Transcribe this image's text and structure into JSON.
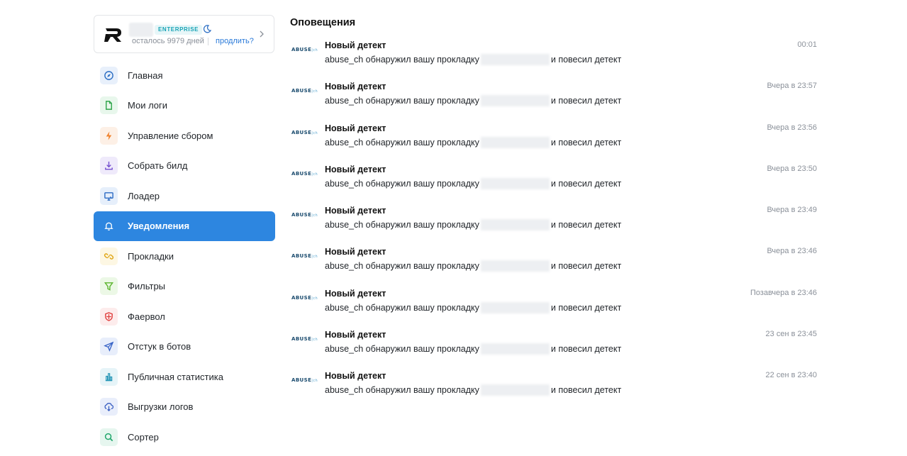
{
  "account": {
    "plan_badge": "ENTERPRISE",
    "days_left": "осталось 9979 дней",
    "renew_link": "продлить?"
  },
  "sidebar": {
    "items": [
      {
        "label": "Главная",
        "icon": "compass-icon",
        "bg": "#e8f0fb",
        "color": "#2d6fc4"
      },
      {
        "label": "Мои логи",
        "icon": "file-icon",
        "bg": "#e8f7ec",
        "color": "#2fa54a"
      },
      {
        "label": "Управление сбором",
        "icon": "lightning-icon",
        "bg": "#fdf0e6",
        "color": "#f0802a"
      },
      {
        "label": "Собрать билд",
        "icon": "download-icon",
        "bg": "#efeafb",
        "color": "#7650d0"
      },
      {
        "label": "Лоадер",
        "icon": "monitor-icon",
        "bg": "#e6effb",
        "color": "#2c6bc4"
      },
      {
        "label": "Уведомления",
        "icon": "bell-icon",
        "bg": "transparent",
        "color": "#ffffff",
        "active": true
      },
      {
        "label": "Прокладки",
        "icon": "link-icon",
        "bg": "#fdf7e3",
        "color": "#e0a616"
      },
      {
        "label": "Фильтры",
        "icon": "filter-icon",
        "bg": "#ecf8e6",
        "color": "#5bb42e"
      },
      {
        "label": "Фаервол",
        "icon": "shield-icon",
        "bg": "#fdecec",
        "color": "#e0403f"
      },
      {
        "label": "Отстук в ботов",
        "icon": "send-icon",
        "bg": "#e8eefb",
        "color": "#3561c6"
      },
      {
        "label": "Публичная статистика",
        "icon": "bar-chart-icon",
        "bg": "#e6f4f8",
        "color": "#2395b6"
      },
      {
        "label": "Выгрузки логов",
        "icon": "cloud-download-icon",
        "bg": "#e9eefb",
        "color": "#3a5fc2"
      },
      {
        "label": "Сортер",
        "icon": "search-icon",
        "bg": "#e6f6ef",
        "color": "#1fa66a"
      }
    ]
  },
  "main": {
    "title": "Оповещения",
    "notifications": [
      {
        "logo": "ABUSE",
        "logo_suffix": "ch",
        "title": "Новый детект",
        "body_before": "abuse_ch обнаружил вашу прокладку",
        "body_after": "и повесил детект",
        "time": "00:01"
      },
      {
        "logo": "ABUSE",
        "logo_suffix": "ch",
        "title": "Новый детект",
        "body_before": "abuse_ch обнаружил вашу прокладку",
        "body_after": "и повесил детект",
        "time": "Вчера в 23:57"
      },
      {
        "logo": "ABUSE",
        "logo_suffix": "ch",
        "title": "Новый детект",
        "body_before": "abuse_ch обнаружил вашу прокладку",
        "body_after": "и повесил детект",
        "time": "Вчера в 23:56"
      },
      {
        "logo": "ABUSE",
        "logo_suffix": "ch",
        "title": "Новый детект",
        "body_before": "abuse_ch обнаружил вашу прокладку",
        "body_after": "и повесил детект",
        "time": "Вчера в 23:50"
      },
      {
        "logo": "ABUSE",
        "logo_suffix": "ch",
        "title": "Новый детект",
        "body_before": "abuse_ch обнаружил вашу прокладку",
        "body_after": "и повесил детект",
        "time": "Вчера в 23:49"
      },
      {
        "logo": "ABUSE",
        "logo_suffix": "ch",
        "title": "Новый детект",
        "body_before": "abuse_ch обнаружил вашу прокладку",
        "body_after": "и повесил детект",
        "time": "Вчера в 23:46"
      },
      {
        "logo": "ABUSE",
        "logo_suffix": "ch",
        "title": "Новый детект",
        "body_before": "abuse_ch обнаружил вашу прокладку",
        "body_after": "и повесил детект",
        "time": "Позавчера в 23:46"
      },
      {
        "logo": "ABUSE",
        "logo_suffix": "ch",
        "title": "Новый детект",
        "body_before": "abuse_ch обнаружил вашу прокладку",
        "body_after": "и повесил детект",
        "time": "23 сен в 23:45"
      },
      {
        "logo": "ABUSE",
        "logo_suffix": "ch",
        "title": "Новый детект",
        "body_before": "abuse_ch обнаружил вашу прокладку",
        "body_after": "и повесил детект",
        "time": "22 сен в 23:40"
      }
    ]
  }
}
